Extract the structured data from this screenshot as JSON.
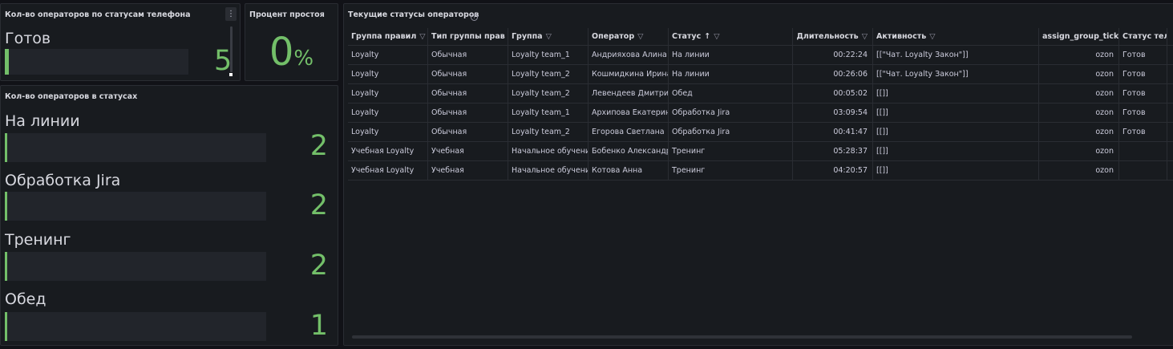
{
  "panels": {
    "phone_status": {
      "title": "Кол-во операторов по статусам телефона",
      "menu_icon": "more-vertical-icon",
      "rows": [
        {
          "label": "Готов",
          "value": "5",
          "fraction": 0.02
        }
      ]
    },
    "idle": {
      "title": "Процент простоя",
      "value": "0",
      "unit": "%"
    },
    "statuses": {
      "title": "Кол-во операторов в статусах",
      "rows": [
        {
          "label": "На линии",
          "value": "2",
          "fraction": 0.01
        },
        {
          "label": "Обработка Jira",
          "value": "2",
          "fraction": 0.01
        },
        {
          "label": "Тренинг",
          "value": "2",
          "fraction": 0.01
        },
        {
          "label": "Обед",
          "value": "1",
          "fraction": 0.005
        }
      ]
    },
    "current": {
      "title": "Текущие статусы операторов",
      "info_icon": "info-circle-icon",
      "columns": [
        {
          "label": "Группа правил",
          "filter": true
        },
        {
          "label": "Тип группы прав",
          "filter": true
        },
        {
          "label": "Группа",
          "filter": true
        },
        {
          "label": "Оператор",
          "filter": true
        },
        {
          "label": "Статус",
          "filter": true,
          "sort": "↑"
        },
        {
          "label": "Длительность",
          "filter": true
        },
        {
          "label": "Активность",
          "filter": true
        },
        {
          "label": "assign_group_tick",
          "filter": true
        },
        {
          "label": "Статус теле",
          "filter": false
        }
      ],
      "rows": [
        [
          "Loyalty",
          "Обычная",
          "Loyalty team_1",
          "Андрияхова Алина",
          "На линии",
          "00:22:24",
          "[[\"Чат. Loyalty Закон\"]]",
          "ozon",
          "Готов"
        ],
        [
          "Loyalty",
          "Обычная",
          "Loyalty team_2",
          "Кошмидкина Ирина",
          "На линии",
          "00:26:06",
          "[[\"Чат. Loyalty Закон\"]]",
          "ozon",
          "Готов"
        ],
        [
          "Loyalty",
          "Обычная",
          "Loyalty team_2",
          "Левендеев Дмитрий",
          "Обед",
          "00:05:02",
          "[[]]",
          "ozon",
          "Готов"
        ],
        [
          "Loyalty",
          "Обычная",
          "Loyalty team_1",
          "Архипова Екатерина",
          "Обработка Jira",
          "03:09:54",
          "[[]]",
          "ozon",
          "Готов"
        ],
        [
          "Loyalty",
          "Обычная",
          "Loyalty team_2",
          "Егорова Светлана",
          "Обработка Jira",
          "00:41:47",
          "[[]]",
          "ozon",
          "Готов"
        ],
        [
          "Учебная Loyalty",
          "Учебная",
          "Начальное обучение",
          "Бобенко Александр",
          "Тренинг",
          "05:28:37",
          "[[]]",
          "ozon",
          ""
        ],
        [
          "Учебная Loyalty",
          "Учебная",
          "Начальное обучение",
          "Котова Анна",
          "Тренинг",
          "04:20:57",
          "[[]]",
          "ozon",
          ""
        ]
      ]
    }
  },
  "colors": {
    "accent": "#73bf69",
    "panel_bg": "#181b1f",
    "page_bg": "#111217"
  }
}
